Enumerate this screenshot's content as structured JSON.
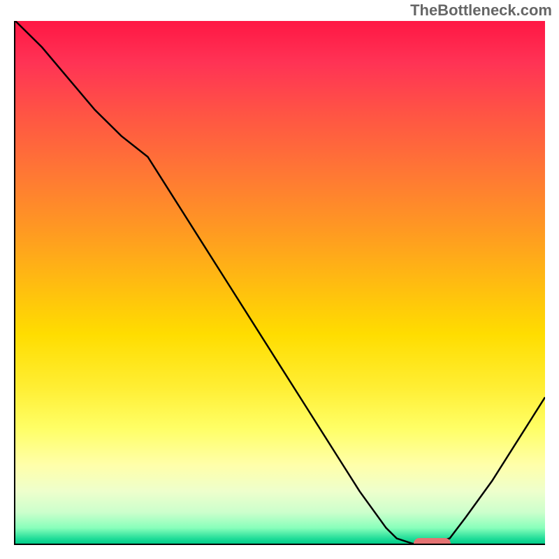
{
  "watermark": "TheBottleneck.com",
  "chart_data": {
    "type": "line",
    "title": "",
    "xlabel": "",
    "ylabel": "",
    "x": [
      0,
      5,
      10,
      15,
      20,
      25,
      30,
      35,
      40,
      45,
      50,
      55,
      60,
      65,
      70,
      72,
      75,
      78,
      82,
      85,
      90,
      95,
      100
    ],
    "values": [
      100,
      95,
      89,
      83,
      78,
      74,
      66,
      58,
      50,
      42,
      34,
      26,
      18,
      10,
      3,
      1,
      0,
      0,
      1,
      5,
      12,
      20,
      28
    ],
    "ylim": [
      0,
      100
    ],
    "xlim": [
      0,
      100
    ],
    "marker": {
      "x_start": 75,
      "x_end": 82,
      "y": 0
    },
    "background_gradient": [
      "#ff1744",
      "#ff9922",
      "#ffee33",
      "#ffffaa",
      "#00cc88"
    ]
  }
}
